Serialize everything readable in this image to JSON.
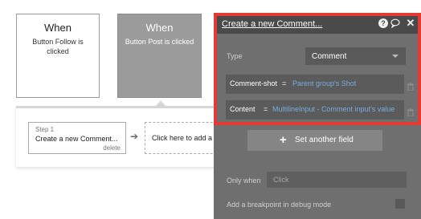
{
  "workflow": {
    "events": [
      {
        "title": "When",
        "description": "Button Follow is clicked"
      },
      {
        "title": "When",
        "description": "Button Post is clicked"
      }
    ],
    "step": {
      "label": "Step 1",
      "name": "Create a new Comment...",
      "delete_label": "delete"
    },
    "add_action_label": "Click here to add a"
  },
  "editor": {
    "title": "Create a new Comment...",
    "icons": [
      "question-icon",
      "comment-icon",
      "close-icon",
      "trash-icon",
      "plus-icon",
      "chevron-down-icon"
    ],
    "type_label": "Type",
    "type_value": "Comment",
    "fields": [
      {
        "name": "Comment-shot",
        "equals": "=",
        "value": "Parent group's Shot"
      },
      {
        "name": "Content",
        "equals": "=",
        "value": "MultilineInput - Comment input's value"
      }
    ],
    "set_field_label": "Set another field",
    "only_when_label": "Only when",
    "only_when_placeholder": "Click",
    "breakpoint_label": "Add a breakpoint in debug mode"
  },
  "colors": {
    "highlight_frame": "#e53a34",
    "editor_bg": "#6f6f6f",
    "header_bg": "#4a4a4a",
    "link_blue": "#79acdf",
    "selected_card": "#9b9b9b"
  }
}
